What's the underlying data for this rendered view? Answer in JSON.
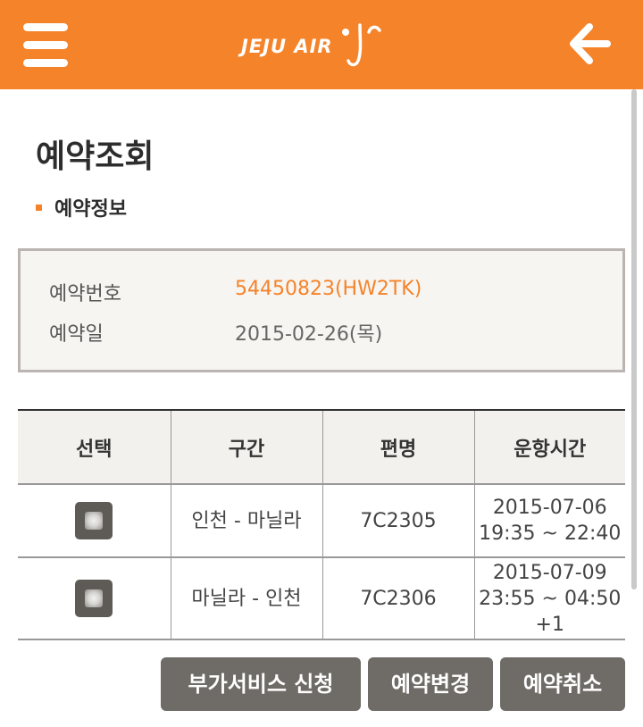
{
  "header": {
    "logo_text": "JEJU AIR",
    "brand_color": "#f5832a",
    "menu_icon": "hamburger-menu-icon",
    "back_icon": "arrow-left-icon"
  },
  "page": {
    "title": "예약조회",
    "section_title": "예약정보"
  },
  "reservation": {
    "number_label": "예약번호",
    "number_value": "54450823(HW2TK)",
    "date_label": "예약일",
    "date_value": "2015-02-26(목)"
  },
  "table": {
    "headers": [
      "선택",
      "구간",
      "편명",
      "운항시간"
    ],
    "rows": [
      {
        "selected": false,
        "route": "인천 - 마닐라",
        "flight": "7C2305",
        "time_line1": "2015-07-06",
        "time_line2": "19:35 ~ 22:40",
        "time_line3": ""
      },
      {
        "selected": false,
        "route": "마닐라 - 인천",
        "flight": "7C2306",
        "time_line1": "2015-07-09",
        "time_line2": "23:55 ~ 04:50",
        "time_line3": "+1"
      }
    ]
  },
  "actions": {
    "extra_service": "부가서비스 신청",
    "change": "예약변경",
    "cancel": "예약취소"
  }
}
